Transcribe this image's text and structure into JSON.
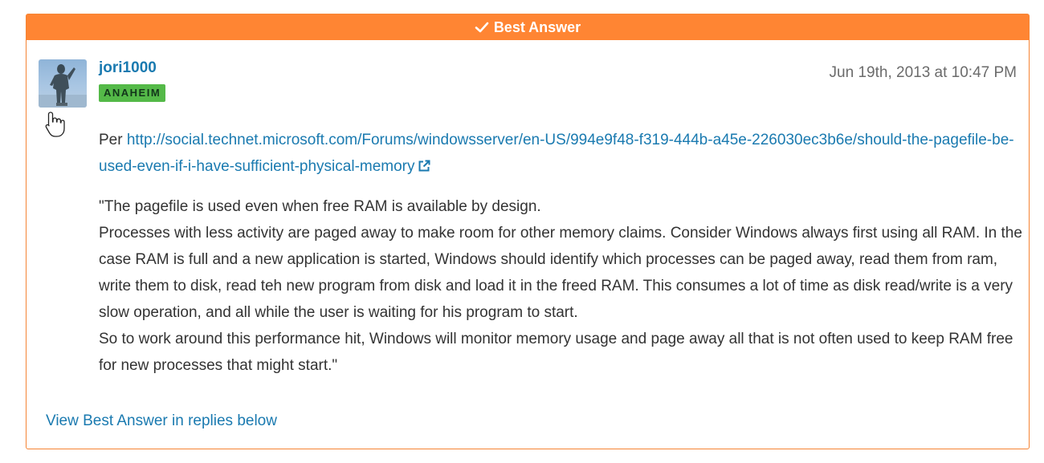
{
  "banner": {
    "label": "Best Answer",
    "icon": "checkmark-icon"
  },
  "post": {
    "author": "jori1000",
    "badge": "ANAHEIM",
    "timestamp": "Jun 19th, 2013 at 10:47 PM",
    "per_label": "Per ",
    "link_text": "http://social.technet.microsoft.com/Forums/windowsserver/en-US/994e9f48-f319-444b-a45e-226030ec3b6e/should-the-pagefile-be-used-even-if-i-have-sufficient-physical-memory",
    "quote_lines": [
      "\"The pagefile is used even when free RAM is available by design.",
      "Processes with less activity are paged away to make room for other memory claims. Consider Windows always first using all RAM. In the case RAM is full and a new application is started, Windows should identify which processes can be paged away, read them from ram, write them to disk, read teh new program from disk and load it in the freed RAM. This consumes a lot of time as disk read/write is a very slow operation, and all while the user is waiting for his program to start.",
      "So to work around this performance hit, Windows will monitor memory usage and page away all that is not often used to keep RAM free for new processes that might start.\""
    ]
  },
  "footer": {
    "view_link": "View Best Answer in replies below"
  },
  "colors": {
    "banner": "#ff8533",
    "border": "#f58434",
    "link": "#1a7ab0",
    "badge": "#54b948"
  }
}
